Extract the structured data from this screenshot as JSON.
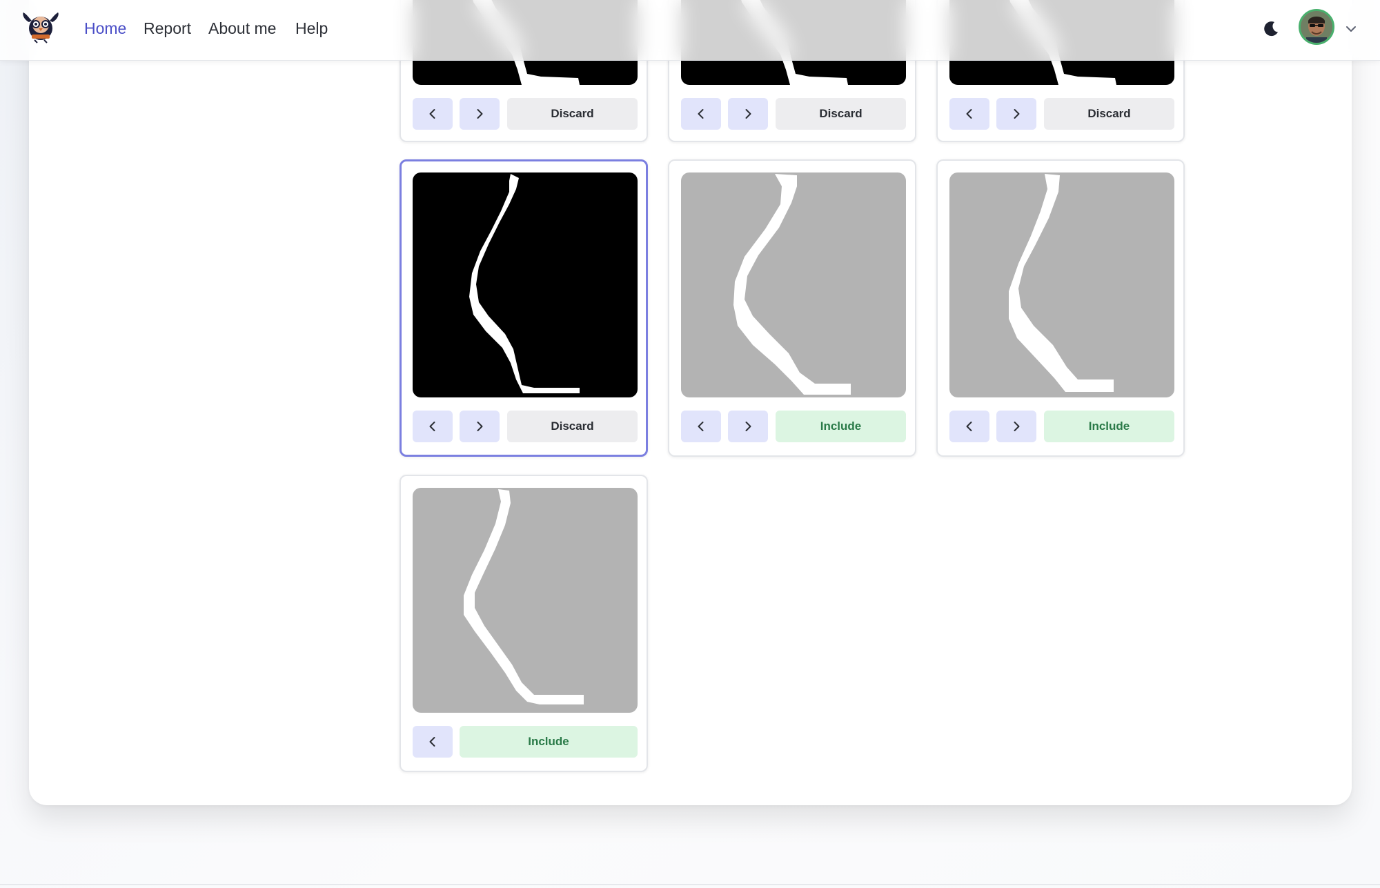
{
  "nav": {
    "home": "Home",
    "report": "Report",
    "about": "About me",
    "help": "Help",
    "active": "Home",
    "accent_color": "#4b4fc7"
  },
  "header_icons": {
    "logo": "owl-logo-icon",
    "theme_toggle": "moon-icon",
    "avatar": "user-avatar",
    "menu": "chevron-down-icon"
  },
  "cards": [
    {
      "state": "discard",
      "background": "black",
      "label": "Discard",
      "prev": true,
      "next": true
    },
    {
      "state": "discard",
      "background": "black",
      "label": "Discard",
      "prev": true,
      "next": true
    },
    {
      "state": "discard",
      "background": "black",
      "label": "Discard",
      "prev": true,
      "next": true
    },
    {
      "state": "discard",
      "background": "black",
      "label": "Discard",
      "prev": true,
      "next": true,
      "selected": true
    },
    {
      "state": "include",
      "background": "gray",
      "label": "Include",
      "prev": true,
      "next": true
    },
    {
      "state": "include",
      "background": "gray",
      "label": "Include",
      "prev": true,
      "next": true
    },
    {
      "state": "include",
      "background": "gray",
      "label": "Include",
      "prev": true,
      "next": false
    }
  ],
  "colors": {
    "discard_bg": "#ededef",
    "include_bg": "#dcf5e2",
    "include_text": "#2a7a48",
    "nav_button_bg": "#e1e4fb",
    "selected_border": "#7b7fe0",
    "avatar_ring": "#49b06d"
  }
}
